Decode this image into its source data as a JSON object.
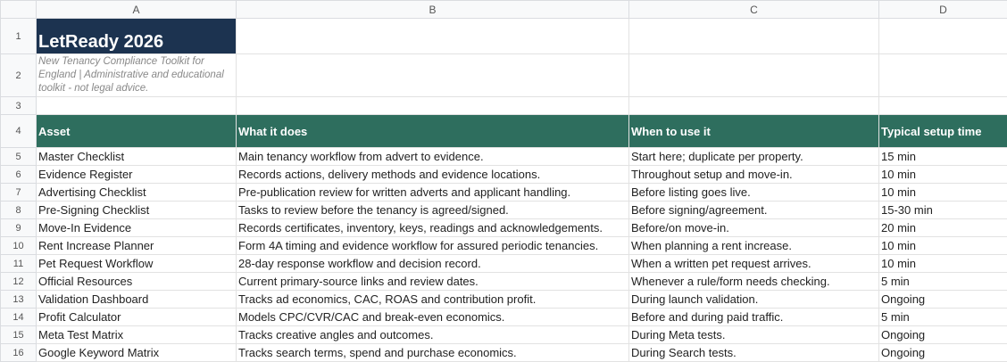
{
  "columns": [
    "A",
    "B",
    "C",
    "D"
  ],
  "title": "LetReady 2026",
  "subtitle": "New Tenancy Compliance Toolkit for England | Administrative and educational toolkit - not legal advice.",
  "table_headers": [
    "Asset",
    "What it does",
    "When to use it",
    "Typical setup time"
  ],
  "rows": [
    {
      "num": "5",
      "cells": [
        "Master Checklist",
        "Main tenancy workflow from advert to evidence.",
        "Start here; duplicate per property.",
        "15 min"
      ]
    },
    {
      "num": "6",
      "cells": [
        "Evidence Register",
        "Records actions, delivery methods and evidence locations.",
        "Throughout setup and move-in.",
        "10 min"
      ]
    },
    {
      "num": "7",
      "cells": [
        "Advertising Checklist",
        "Pre-publication review for written adverts and applicant handling.",
        "Before listing goes live.",
        "10 min"
      ]
    },
    {
      "num": "8",
      "cells": [
        "Pre-Signing Checklist",
        "Tasks to review before the tenancy is agreed/signed.",
        "Before signing/agreement.",
        "15-30 min"
      ]
    },
    {
      "num": "9",
      "cells": [
        "Move-In Evidence",
        "Records certificates, inventory, keys, readings and acknowledgements.",
        "Before/on move-in.",
        "20 min"
      ]
    },
    {
      "num": "10",
      "cells": [
        "Rent Increase Planner",
        "Form 4A timing and evidence workflow for assured periodic tenancies.",
        "When planning a rent increase.",
        "10 min"
      ]
    },
    {
      "num": "11",
      "cells": [
        "Pet Request Workflow",
        "28-day response workflow and decision record.",
        "When a written pet request arrives.",
        "10 min"
      ]
    },
    {
      "num": "12",
      "cells": [
        "Official Resources",
        "Current primary-source links and review dates.",
        "Whenever a rule/form needs checking.",
        "5 min"
      ]
    },
    {
      "num": "13",
      "cells": [
        "Validation Dashboard",
        "Tracks ad economics, CAC, ROAS and contribution profit.",
        "During launch validation.",
        "Ongoing"
      ]
    },
    {
      "num": "14",
      "cells": [
        "Profit Calculator",
        "Models CPC/CVR/CAC and break-even economics.",
        "Before and during paid traffic.",
        "5 min"
      ]
    },
    {
      "num": "15",
      "cells": [
        "Meta Test Matrix",
        "Tracks creative angles and outcomes.",
        "During Meta tests.",
        "Ongoing"
      ]
    },
    {
      "num": "16",
      "cells": [
        "Google Keyword Matrix",
        "Tracks search terms, spend and purchase economics.",
        "During Search tests.",
        "Ongoing"
      ]
    }
  ],
  "colors": {
    "title_bg": "#1c3350",
    "header_bg": "#2e6e5e"
  }
}
